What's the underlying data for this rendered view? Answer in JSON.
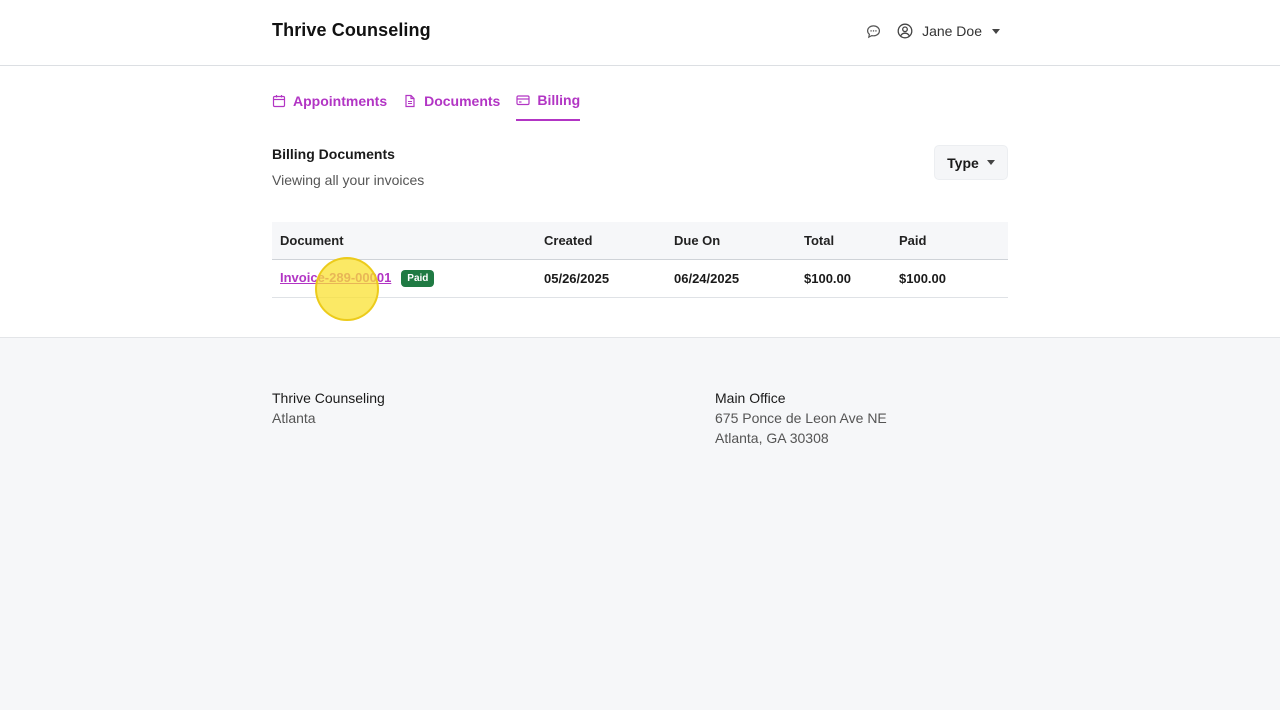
{
  "header": {
    "brand": "Thrive Counseling",
    "user_name": "Jane Doe"
  },
  "tabs": [
    {
      "label": "Appointments",
      "icon": "calendar-icon"
    },
    {
      "label": "Documents",
      "icon": "document-icon"
    },
    {
      "label": "Billing",
      "icon": "credit-card-icon",
      "active": true
    }
  ],
  "section": {
    "title": "Billing Documents",
    "subtitle": "Viewing all your invoices",
    "filter_label": "Type"
  },
  "table": {
    "headers": [
      "Document",
      "Created",
      "Due On",
      "Total",
      "Paid"
    ],
    "rows": [
      {
        "document": "Invoice-289-00001",
        "status": "Paid",
        "created": "05/26/2025",
        "due_on": "06/24/2025",
        "total": "$100.00",
        "paid": "$100.00"
      }
    ]
  },
  "footer": {
    "left": {
      "name": "Thrive Counseling",
      "city": "Atlanta"
    },
    "right": {
      "title": "Main Office",
      "street": "675 Ponce de Leon Ave NE",
      "city_line": "Atlanta, GA 30308"
    }
  },
  "colors": {
    "accent": "#b235c4",
    "badge_paid": "#1f7a43",
    "footer_bg": "#f6f7f9"
  }
}
